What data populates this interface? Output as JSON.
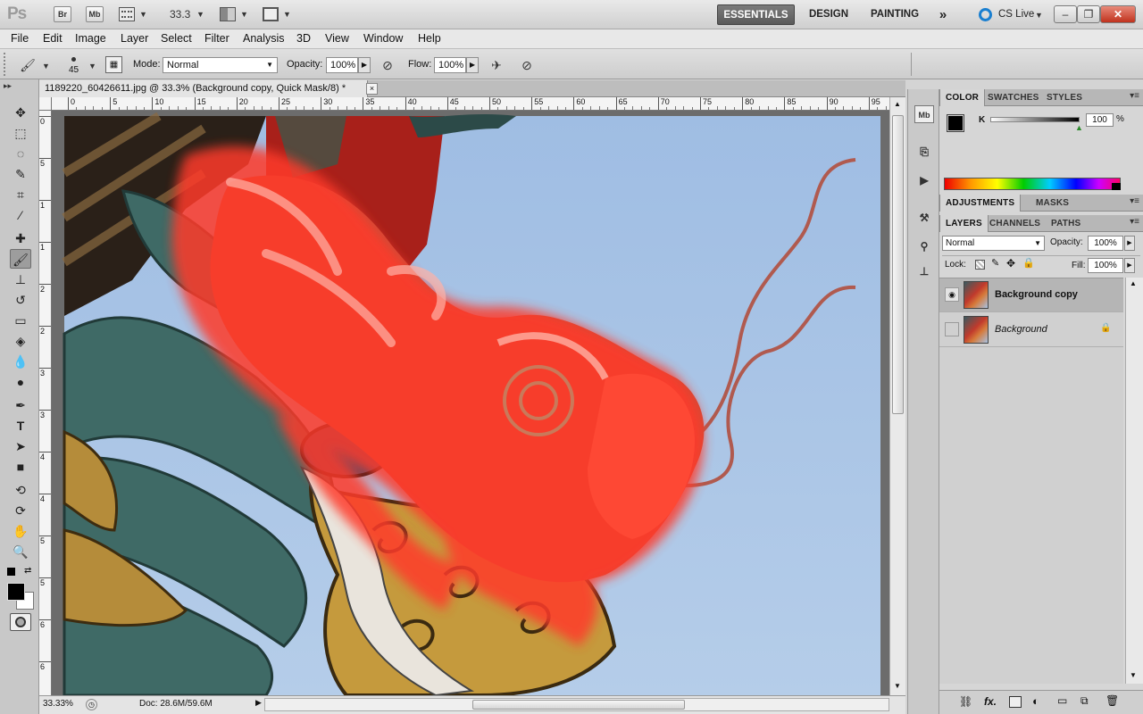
{
  "app": {
    "logo": "Ps",
    "bridge_label": "Br",
    "minibridge_label": "Mb",
    "zoom": "33.3",
    "workspaces": [
      "ESSENTIALS",
      "DESIGN",
      "PAINTING"
    ],
    "active_workspace": "ESSENTIALS",
    "more": "»",
    "cs_live": "CS Live"
  },
  "menus": [
    "File",
    "Edit",
    "Image",
    "Layer",
    "Select",
    "Filter",
    "Analysis",
    "3D",
    "View",
    "Window",
    "Help"
  ],
  "options": {
    "brush_size": "45",
    "mode_label": "Mode:",
    "mode_value": "Normal",
    "opacity_label": "Opacity:",
    "opacity_value": "100%",
    "flow_label": "Flow:",
    "flow_value": "100%"
  },
  "document": {
    "tab_title": "1189220_60426611.jpg @ 33.3% (Background copy, Quick Mask/8) *",
    "close": "×",
    "ruler_h": [
      "0",
      "5",
      "10",
      "15",
      "20",
      "25",
      "30",
      "35",
      "40",
      "45",
      "50",
      "55",
      "60",
      "65",
      "70",
      "75",
      "80",
      "85",
      "90",
      "95"
    ],
    "ruler_v": [
      "0",
      "5",
      "1",
      "1",
      "2",
      "2",
      "3",
      "3",
      "4",
      "4",
      "5",
      "5",
      "6",
      "6"
    ],
    "status_zoom": "33.33%",
    "status_doc": "Doc: 28.6M/59.6M"
  },
  "color_panel": {
    "tabs": [
      "COLOR",
      "SWATCHES",
      "STYLES"
    ],
    "channel": "K",
    "value": "100",
    "unit": "%"
  },
  "adjustments_panel": {
    "tabs": [
      "ADJUSTMENTS",
      "MASKS"
    ]
  },
  "layers_panel": {
    "tabs": [
      "LAYERS",
      "CHANNELS",
      "PATHS"
    ],
    "blend_mode": "Normal",
    "opacity_label": "Opacity:",
    "opacity_value": "100%",
    "lock_label": "Lock:",
    "fill_label": "Fill:",
    "fill_value": "100%",
    "layers": [
      {
        "name": "Background copy",
        "visible": true,
        "selected": true
      },
      {
        "name": "Background",
        "visible": false,
        "selected": false,
        "locked": true
      }
    ],
    "footer_icons": [
      "link-icon",
      "fx-icon",
      "mask-icon",
      "adjustment-icon",
      "group-icon",
      "new-layer-icon",
      "trash-icon"
    ]
  },
  "colors": {
    "quick_mask_overlay": "#ff3a2a",
    "sky": "#a9c3e6",
    "active_ws_bg": "#666666"
  }
}
